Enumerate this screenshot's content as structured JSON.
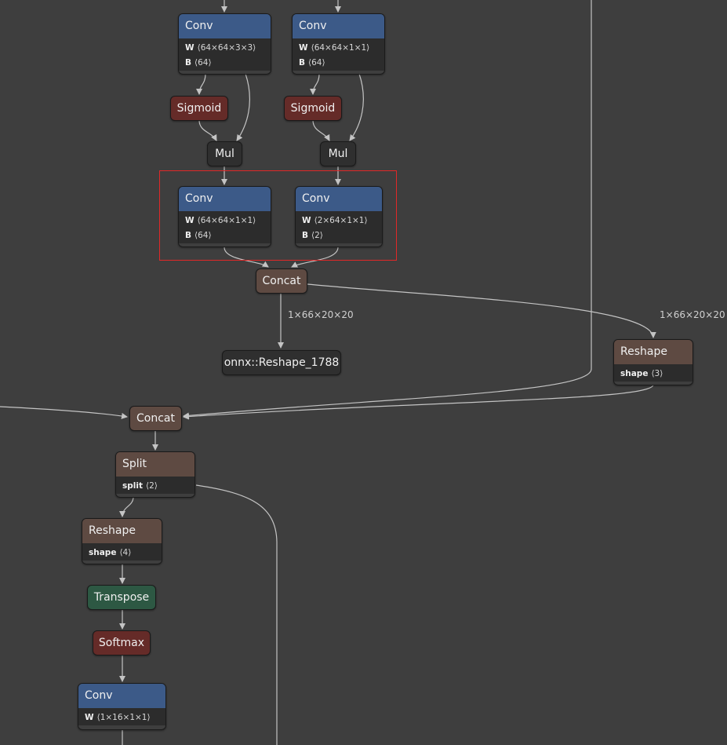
{
  "graph": {
    "conv_top_left": {
      "op": "Conv",
      "attrs": [
        {
          "key": "W",
          "value": "⟨64×64×3×3⟩"
        },
        {
          "key": "B",
          "value": "⟨64⟩"
        }
      ]
    },
    "conv_top_right": {
      "op": "Conv",
      "attrs": [
        {
          "key": "W",
          "value": "⟨64×64×1×1⟩"
        },
        {
          "key": "B",
          "value": "⟨64⟩"
        }
      ]
    },
    "sigmoid_left": {
      "op": "Sigmoid"
    },
    "sigmoid_right": {
      "op": "Sigmoid"
    },
    "mul_left": {
      "op": "Mul"
    },
    "mul_right": {
      "op": "Mul"
    },
    "conv_sel_left": {
      "op": "Conv",
      "attrs": [
        {
          "key": "W",
          "value": "⟨64×64×1×1⟩"
        },
        {
          "key": "B",
          "value": "⟨64⟩"
        }
      ]
    },
    "conv_sel_right": {
      "op": "Conv",
      "attrs": [
        {
          "key": "W",
          "value": "⟨2×64×1×1⟩"
        },
        {
          "key": "B",
          "value": "⟨2⟩"
        }
      ]
    },
    "concat_top": {
      "op": "Concat"
    },
    "edge_label_output": "1×66×20×20",
    "edge_label_reshape": "1×66×20×20",
    "output_node": {
      "label": "onnx::Reshape_1788"
    },
    "reshape_right": {
      "op": "Reshape",
      "attrs": [
        {
          "key": "shape",
          "value": "⟨3⟩"
        }
      ]
    },
    "concat_bottom": {
      "op": "Concat"
    },
    "split": {
      "op": "Split",
      "attrs": [
        {
          "key": "split",
          "value": "⟨2⟩"
        }
      ]
    },
    "reshape_left": {
      "op": "Reshape",
      "attrs": [
        {
          "key": "shape",
          "value": "⟨4⟩"
        }
      ]
    },
    "transpose": {
      "op": "Transpose"
    },
    "softmax": {
      "op": "Softmax"
    },
    "conv_bottom": {
      "op": "Conv",
      "attrs": [
        {
          "key": "W",
          "value": "⟨1×16×1×1⟩"
        }
      ]
    }
  },
  "colors": {
    "background": "#3e3e3e",
    "conv": "#3c5a88",
    "activation": "#652b28",
    "shape_op": "#5e4a42",
    "transpose": "#2d5843",
    "neutral": "#2f2f2f",
    "selection": "#e02828",
    "edge": "#c4c4c4"
  }
}
